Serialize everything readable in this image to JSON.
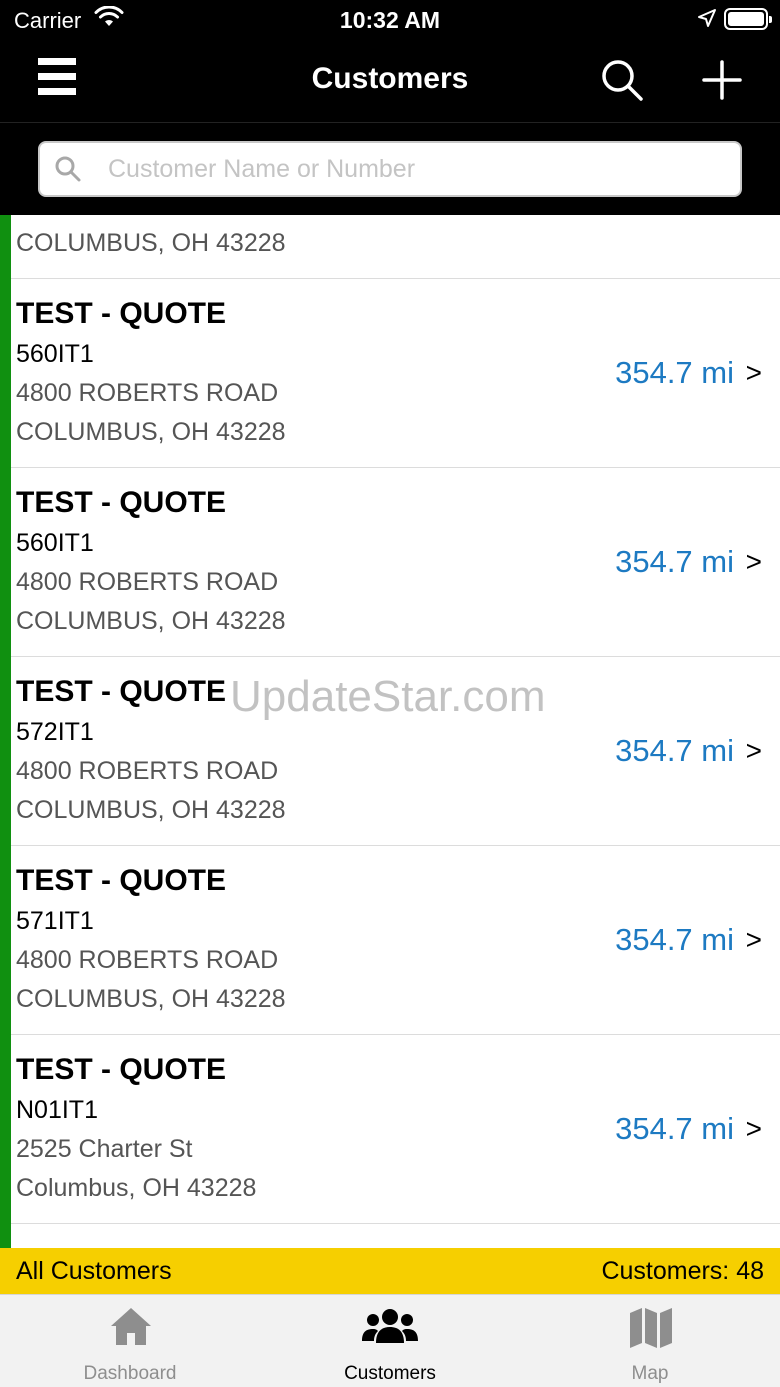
{
  "status_bar": {
    "carrier": "Carrier",
    "time": "10:32 AM"
  },
  "nav": {
    "title": "Customers",
    "menu_icon": "hamburger-menu-icon",
    "search_icon": "search-icon",
    "add_icon": "plus-icon"
  },
  "search": {
    "placeholder": "Customer Name or Number",
    "value": ""
  },
  "list": {
    "partial_city": "COLUMBUS, OH 43228",
    "rows": [
      {
        "name": "TEST - QUOTE",
        "number": "560IT1",
        "street": "4800 ROBERTS ROAD",
        "city": "COLUMBUS, OH 43228",
        "distance": "354.7 mi",
        "chevron": ">"
      },
      {
        "name": "TEST - QUOTE",
        "number": "560IT1",
        "street": "4800 ROBERTS ROAD",
        "city": "COLUMBUS, OH 43228",
        "distance": "354.7 mi",
        "chevron": ">"
      },
      {
        "name": "TEST - QUOTE",
        "number": "572IT1",
        "street": "4800 ROBERTS ROAD",
        "city": "COLUMBUS, OH 43228",
        "distance": "354.7 mi",
        "chevron": ">"
      },
      {
        "name": "TEST - QUOTE",
        "number": "571IT1",
        "street": "4800 ROBERTS ROAD",
        "city": "COLUMBUS, OH 43228",
        "distance": "354.7 mi",
        "chevron": ">"
      },
      {
        "name": "TEST - QUOTE",
        "number": "N01IT1",
        "street": "2525 Charter St",
        "city": "Columbus, OH 43228",
        "distance": "354.7 mi",
        "chevron": ">"
      }
    ]
  },
  "watermark": "UpdateStar.com",
  "footer": {
    "filter_label": "All Customers",
    "count_label": "Customers: 48"
  },
  "tabs": [
    {
      "label": "Dashboard",
      "icon": "home-icon",
      "active": false
    },
    {
      "label": "Customers",
      "icon": "users-icon",
      "active": true
    },
    {
      "label": "Map",
      "icon": "map-icon",
      "active": false
    }
  ],
  "colors": {
    "accent_green": "#109010",
    "distance_blue": "#1d7ac2",
    "footer_yellow": "#f6cf00"
  }
}
